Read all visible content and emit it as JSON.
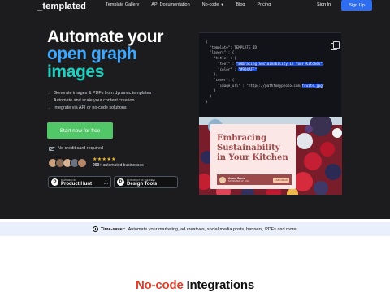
{
  "nav": {
    "logo": "_templated",
    "links": [
      "Template Gallery",
      "API Documentation",
      "No-code",
      "Blog",
      "Pricing"
    ],
    "signin": "Sign In",
    "signup": "Sign Up"
  },
  "hero": {
    "headline_1": "Automate your",
    "headline_2": "open graph",
    "headline_3": "images",
    "bullets": [
      "Generate images & PDFs from dynamic templates",
      "Automate and scale your content creation",
      "Integrate via API or no-code solutions"
    ],
    "cta": "Start now for free",
    "no_card": "No credit card required",
    "stars": "★★★★★",
    "businesses_count": "900+",
    "businesses_label": "automated businesses",
    "badge_ph_small": "FEATURED ON",
    "badge_ph_big": "Product Hunt",
    "badge_ph_votes": "261",
    "badge_dt_small": "#2 PRODUCT OF THE WEEK",
    "badge_dt_big": "Design Tools"
  },
  "code": {
    "l1": "{",
    "l2": "  \"template\": TEMPLATE_ID,",
    "l3": "  \"layers\" : {",
    "l4": "    \"title\" : {",
    "l5_key": "      \"text\" : ",
    "l5_val": "\"Embracing Sustainability In Your Kitchen\"",
    "l6_key": "      \"color\" : ",
    "l6_val": "\"#9D4AFF\"",
    "l7": "    },",
    "l8": "    \"cover\": {",
    "l9_key": "      \"image_url\" : \"https://pathtomyphoto.com/",
    "l9_val": "fruits.jpg",
    "l9_end": "\"",
    "l10": "    }",
    "l11": "  }",
    "l12": "}"
  },
  "preview": {
    "title": "Embracing Sustainability in Your Kitchen",
    "author": "Adam Sams",
    "date": "NOVEMBER 22, 2022",
    "button": "5 MIN READ"
  },
  "timesaver": {
    "label": "Time-saver:",
    "text": "Automate your marketing, ad creatives, social media posts, banners, PDFs and more."
  },
  "integrations": {
    "highlight": "No-code",
    "rest": "Integrations"
  },
  "colors": {
    "bg_dark": "#1c1c1e",
    "accent_blue": "#2f6df0",
    "headline_blue": "#3ea8ff",
    "headline_teal": "#1ed0c0",
    "cta_green": "#52c768",
    "timesaver_bg": "#eaf0fb"
  }
}
